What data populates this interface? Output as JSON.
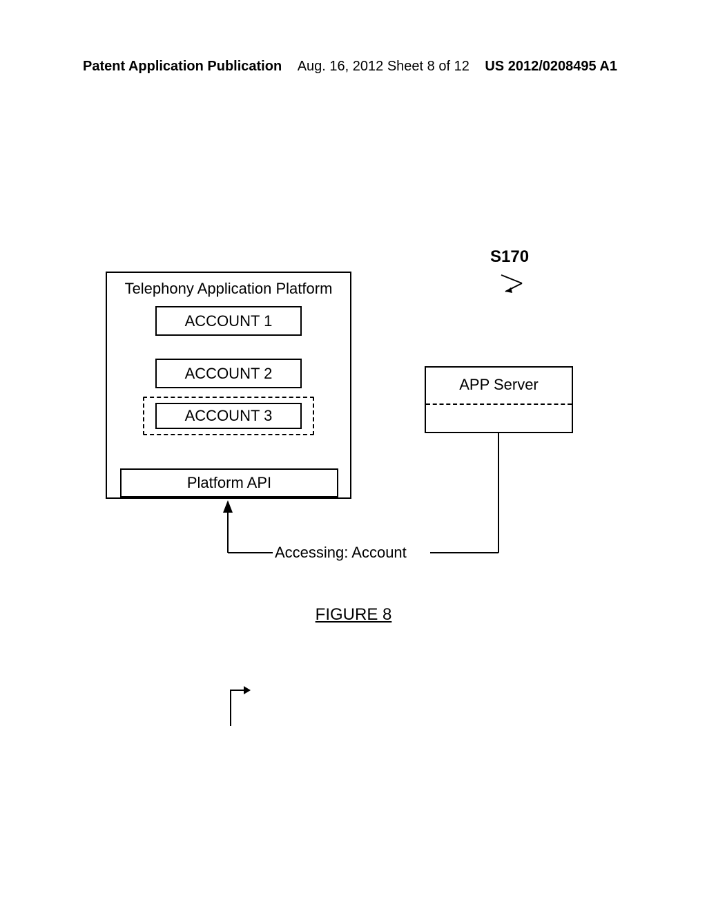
{
  "header": {
    "left": "Patent Application Publication",
    "center": "Aug. 16, 2012   Sheet 8 of 12",
    "right": "US 2012/0208495 A1"
  },
  "diagram": {
    "platform_title": "Telephony Application Platform",
    "account1": "ACCOUNT 1",
    "account2": "ACCOUNT 2",
    "account3": "ACCOUNT 3",
    "api_label": "Platform API",
    "app_server": "APP Server",
    "step_label": "S170",
    "accessing": "Accessing: Account",
    "figure": "FIGURE 8"
  }
}
